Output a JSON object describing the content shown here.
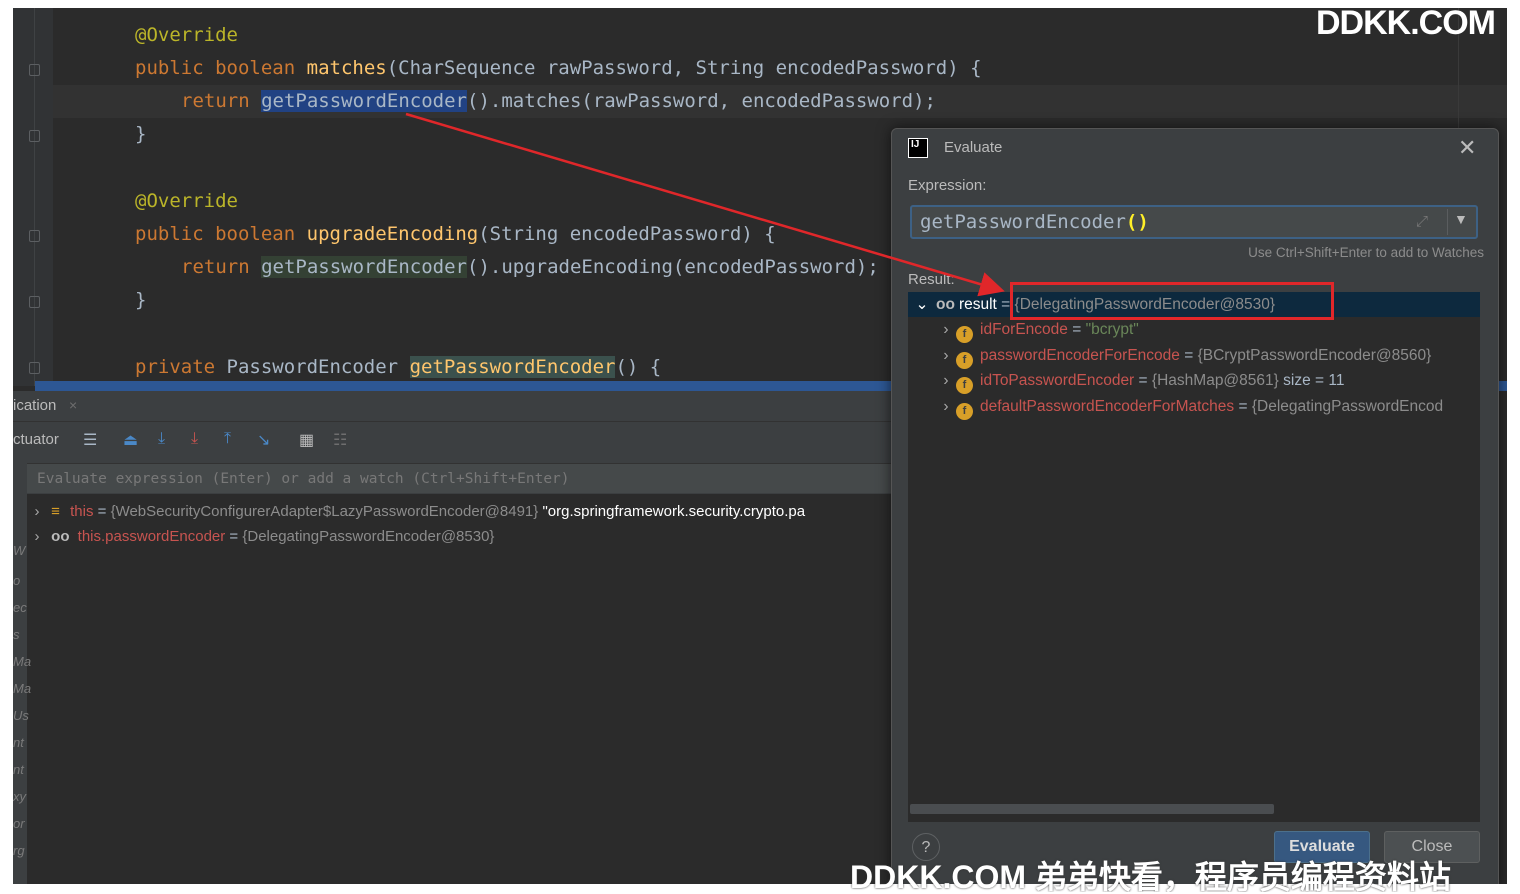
{
  "editor": {
    "lines": [
      {
        "annotation": "@Override"
      },
      {
        "kw1": "public",
        "kw2": "boolean",
        "method": "matches",
        "params": "(CharSequence rawPassword, String encodedPassword) {"
      },
      {
        "kw": "return",
        "call": "getPasswordEncoder",
        "rest": "().matches(rawPassword, encodedPassword);"
      },
      {
        "brace": "}"
      },
      {
        "annotation": "@Override"
      },
      {
        "kw1": "public",
        "kw2": "boolean",
        "method": "upgradeEncoding",
        "params": "(String encodedPassword) {"
      },
      {
        "kw": "return",
        "call": "getPasswordEncoder",
        "rest": "().upgradeEncoding(encodedPassword);"
      },
      {
        "brace": "}"
      },
      {
        "kw1": "private",
        "type": "PasswordEncoder",
        "method": "getPasswordEncoder",
        "params": "() {"
      }
    ]
  },
  "panel": {
    "tab_label": "ication",
    "tab_close": "×",
    "toolbar_label": "ctuator",
    "eval_placeholder": "Evaluate expression (Enter) or add a watch (Ctrl+Shift+Enter)",
    "variables": [
      {
        "name": "this",
        "eq": "=",
        "value": "{WebSecurityConfigurerAdapter$LazyPasswordEncoder@8491}",
        "extra": "\"org.springframework.security.crypto.pa"
      },
      {
        "name": "this.passwordEncoder",
        "eq": "=",
        "value": "{DelegatingPasswordEncoder@8530}"
      }
    ],
    "left_cut_labels": [
      "W",
      "o",
      "ec",
      "s",
      "Ma",
      "Ma",
      "Us",
      "nt",
      "nt",
      "xy",
      "or",
      "rg"
    ]
  },
  "dialog": {
    "title": "Evaluate",
    "expression_label": "Expression:",
    "expression_value": "getPasswordEncoder",
    "expression_parens": "()",
    "hint": "Use Ctrl+Shift+Enter to add to Watches",
    "result_label": "Result:",
    "result": {
      "name": "result",
      "eq": "=",
      "value": "{DelegatingPasswordEncoder@8530}"
    },
    "fields": [
      {
        "name": "idForEncode",
        "eq": "=",
        "value": "\"bcrypt\""
      },
      {
        "name": "passwordEncoderForEncode",
        "eq": "=",
        "value": "{BCryptPasswordEncoder@8560}"
      },
      {
        "name": "idToPasswordEncoder",
        "eq": "=",
        "value": "{HashMap@8561}",
        "extra": "size = 11"
      },
      {
        "name": "defaultPasswordEncoderForMatches",
        "eq": "=",
        "value": "{DelegatingPasswordEncod"
      }
    ],
    "help": "?",
    "evaluate_button": "Evaluate",
    "close_button": "Close"
  },
  "watermark": {
    "top": "DDKK.COM",
    "bottom": "DDKK.COM 弟弟快看，程序员编程资料站"
  },
  "colors": {
    "annotation_red": "#e0272a",
    "keyword": "#cc7832",
    "method": "#ffc66d",
    "selection": "#214283"
  }
}
